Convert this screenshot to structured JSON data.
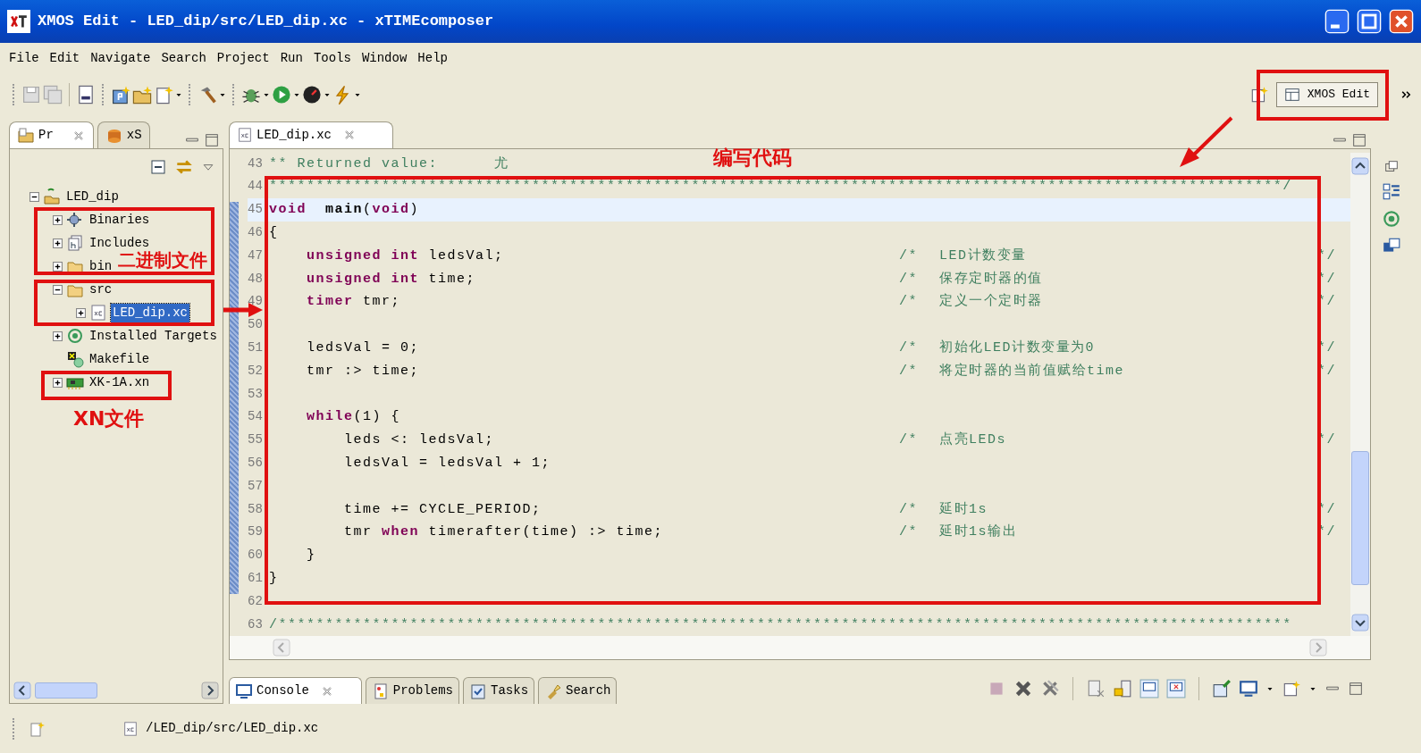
{
  "window": {
    "title": "XMOS Edit - LED_dip/src/LED_dip.xc - xTIMEcomposer"
  },
  "menu": [
    "File",
    "Edit",
    "Navigate",
    "Search",
    "Project",
    "Run",
    "Tools",
    "Window",
    "Help"
  ],
  "perspective": {
    "label": "XMOS Edit",
    "selected": true
  },
  "left_panel": {
    "tabs": [
      {
        "label": "Pr",
        "selected": true
      },
      {
        "label": "xS",
        "selected": false
      }
    ],
    "tree": [
      {
        "label": "LED_dip",
        "kind": "project",
        "expanded": true,
        "selected": false,
        "children": [
          {
            "label": "Binaries",
            "kind": "binaries",
            "expanded": false,
            "selected": false
          },
          {
            "label": "Includes",
            "kind": "includes",
            "expanded": false,
            "selected": false
          },
          {
            "label": "bin",
            "kind": "folder",
            "expanded": false,
            "selected": false
          },
          {
            "label": "src",
            "kind": "folder",
            "expanded": true,
            "selected": false,
            "children": [
              {
                "label": "LED_dip.xc",
                "kind": "source",
                "expanded": false,
                "selected": true
              }
            ]
          },
          {
            "label": "Installed Targets",
            "kind": "targets",
            "expanded": false,
            "selected": false
          },
          {
            "label": "Makefile",
            "kind": "makefile",
            "selected": false
          },
          {
            "label": "XK-1A.xn",
            "kind": "board",
            "expanded": false,
            "selected": false
          }
        ]
      }
    ]
  },
  "editor": {
    "tabs": [
      {
        "label": "LED_dip.xc",
        "selected": true
      }
    ],
    "lines": [
      {
        "number": "43",
        "current": false,
        "code": [
          {
            "kind": "comment",
            "text": "** Returned value:      尤"
          }
        ]
      },
      {
        "number": "44",
        "current": false,
        "code": [
          {
            "kind": "comment",
            "text": "************************************************************************************************************/"
          }
        ]
      },
      {
        "number": "45",
        "current": true,
        "code": [
          {
            "kind": "keyword",
            "text": "void"
          },
          {
            "kind": "function",
            "text": "  main"
          },
          {
            "kind": "plain",
            "text": "("
          },
          {
            "kind": "keyword",
            "text": "void"
          },
          {
            "kind": "plain",
            "text": ")"
          }
        ]
      },
      {
        "number": "46",
        "current": false,
        "code": [
          {
            "kind": "plain",
            "text": "{"
          }
        ]
      },
      {
        "number": "47",
        "current": false,
        "code": [
          {
            "kind": "keyword",
            "text": "    unsigned int"
          },
          {
            "kind": "plain",
            "text": " ledsVal;"
          }
        ],
        "comment": {
          "open": "/*",
          "text": "LED计数变量",
          "close": "*/"
        }
      },
      {
        "number": "48",
        "current": false,
        "code": [
          {
            "kind": "keyword",
            "text": "    unsigned int"
          },
          {
            "kind": "plain",
            "text": " time;"
          }
        ],
        "comment": {
          "open": "/*",
          "text": "保存定时器的值",
          "close": "*/"
        }
      },
      {
        "number": "49",
        "current": false,
        "code": [
          {
            "kind": "keyword",
            "text": "    timer"
          },
          {
            "kind": "plain",
            "text": " tmr;"
          }
        ],
        "comment": {
          "open": "/*",
          "text": "定义一个定时器",
          "close": "*/"
        }
      },
      {
        "number": "50",
        "current": false
      },
      {
        "number": "51",
        "current": false,
        "code": [
          {
            "kind": "plain",
            "text": "    ledsVal = 0;"
          }
        ],
        "comment": {
          "open": "/*",
          "text": "初始化LED计数变量为0",
          "close": "*/"
        }
      },
      {
        "number": "52",
        "current": false,
        "code": [
          {
            "kind": "plain",
            "text": "    tmr :> time;"
          }
        ],
        "comment": {
          "open": "/*",
          "text": "将定时器的当前值赋给time",
          "close": "*/"
        }
      },
      {
        "number": "53",
        "current": false
      },
      {
        "number": "54",
        "current": false,
        "code": [
          {
            "kind": "keyword",
            "text": "    while"
          },
          {
            "kind": "plain",
            "text": "(1) {"
          }
        ]
      },
      {
        "number": "55",
        "current": false,
        "code": [
          {
            "kind": "plain",
            "text": "        leds <: ledsVal;"
          }
        ],
        "comment": {
          "open": "/*",
          "text": "点亮LEDs",
          "close": "*/"
        }
      },
      {
        "number": "56",
        "current": false,
        "code": [
          {
            "kind": "plain",
            "text": "        ledsVal = ledsVal + 1;"
          }
        ]
      },
      {
        "number": "57",
        "current": false
      },
      {
        "number": "58",
        "current": false,
        "code": [
          {
            "kind": "plain",
            "text": "        time += CYCLE_PERIOD;"
          }
        ],
        "comment": {
          "open": "/*",
          "text": "延时1s",
          "close": "*/"
        }
      },
      {
        "number": "59",
        "current": false,
        "code": [
          {
            "kind": "plain",
            "text": "        tmr "
          },
          {
            "kind": "keyword",
            "text": "when"
          },
          {
            "kind": "plain",
            "text": " timerafter(time) :> time;"
          }
        ],
        "comment": {
          "open": "/*",
          "text": "延时1s输出",
          "close": "*/"
        }
      },
      {
        "number": "60",
        "current": false,
        "code": [
          {
            "kind": "plain",
            "text": "    }"
          }
        ]
      },
      {
        "number": "61",
        "current": false,
        "code": [
          {
            "kind": "plain",
            "text": "}"
          }
        ]
      },
      {
        "number": "62",
        "current": false
      },
      {
        "number": "63",
        "current": false,
        "code": [
          {
            "kind": "comment",
            "text": "/************************************************************************************************************"
          }
        ]
      }
    ]
  },
  "bottom_panel": {
    "tabs": [
      {
        "label": "Console",
        "kind": "console",
        "selected": true
      },
      {
        "label": "Problems",
        "kind": "problems",
        "selected": false
      },
      {
        "label": "Tasks",
        "kind": "tasks",
        "selected": false
      },
      {
        "label": "Search",
        "kind": "search",
        "selected": false
      }
    ]
  },
  "status_bar": {
    "path": "/LED_dip/src/LED_dip.xc"
  },
  "annotations": [
    {
      "text": "二进制文件"
    },
    {
      "text": "XN文件"
    },
    {
      "text": "编写代码"
    }
  ]
}
